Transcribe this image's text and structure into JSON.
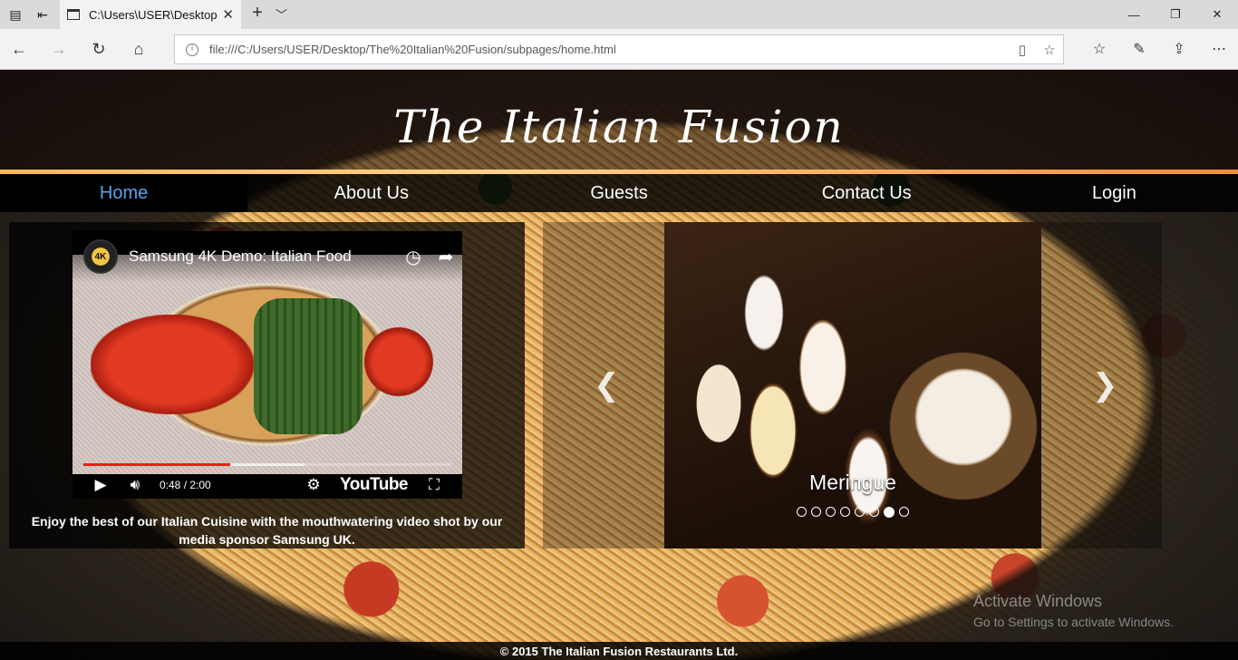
{
  "browser": {
    "tab_title": "C:\\Users\\USER\\Desktop",
    "address": "file:///C:/Users/USER/Desktop/The%20Italian%20Fusion/subpages/home.html",
    "icons": [
      "tab-manager-icon",
      "set-aside-tabs-icon",
      "page-icon",
      "close-icon",
      "plus-icon",
      "chevron-down-icon",
      "back-icon",
      "forward-icon",
      "refresh-icon",
      "home-icon",
      "info-icon",
      "reading-view-icon",
      "star-icon",
      "favorites-icon",
      "pen-icon",
      "share-icon",
      "more-icon",
      "minimize-icon",
      "maximize-icon",
      "window-close-icon"
    ]
  },
  "site": {
    "logo": "The Italian Fusion",
    "nav": [
      "Home",
      "About Us",
      "Guests",
      "Contact Us",
      "Login"
    ],
    "active_nav": "Home",
    "video": {
      "channel_badge": "4K",
      "title": "Samsung 4K Demo: Italian Food",
      "time": "0:48 / 2:00",
      "played_fraction": 0.4,
      "buffered_fraction": 0.6,
      "brand": "YouTube"
    },
    "video_caption": "Enjoy the best of our Italian Cuisine with the mouthwatering video shot by our media sponsor Samsung UK.",
    "slider": {
      "caption": "Meringue",
      "dot_count": 8,
      "active_dot": 6
    },
    "footer": "© 2015 The Italian Fusion Restaurants Ltd."
  },
  "os": {
    "watermark_title": "Activate Windows",
    "watermark_sub": "Go to Settings to activate Windows."
  },
  "colors": {
    "active_nav": "#5ea2e8",
    "progress_played": "#e52117"
  }
}
